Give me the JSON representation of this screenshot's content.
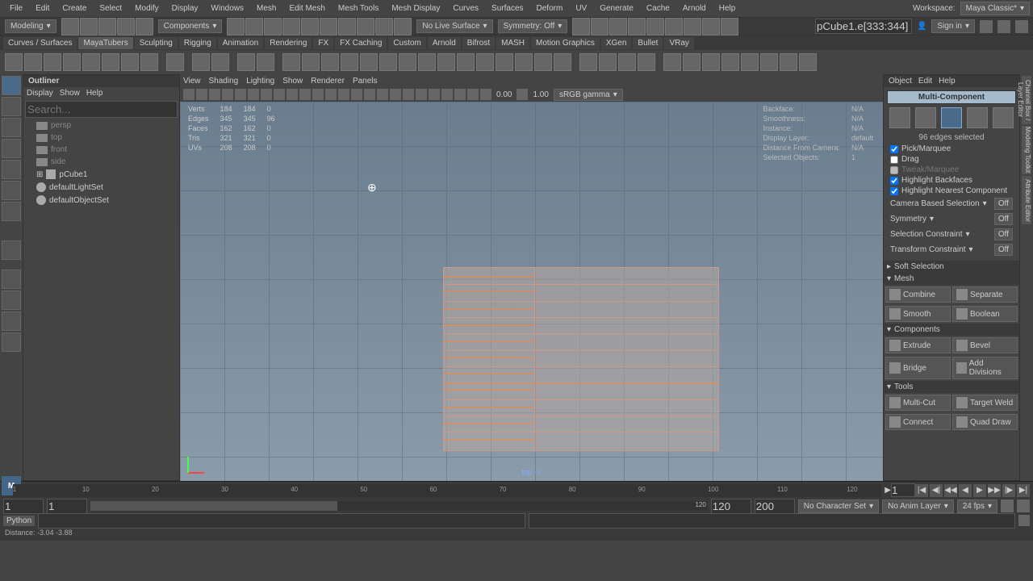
{
  "menubar": [
    "File",
    "Edit",
    "Create",
    "Select",
    "Modify",
    "Display",
    "Windows",
    "Mesh",
    "Edit Mesh",
    "Mesh Tools",
    "Mesh Display",
    "Curves",
    "Surfaces",
    "Deform",
    "UV",
    "Generate",
    "Cache",
    "Arnold",
    "Help"
  ],
  "workspace": {
    "label": "Workspace:",
    "value": "Maya Classic*"
  },
  "status": {
    "menuset": "Modeling",
    "componentmode": "Components",
    "symmetry": "Symmetry: Off",
    "livesurf": "No Live Surface",
    "signin": "Sign in",
    "selpath": "pCube1.e[333:344]"
  },
  "shelftabs": [
    "Curves / Surfaces",
    "MayaTubers",
    "Sculpting",
    "Rigging",
    "Animation",
    "Rendering",
    "FX",
    "FX Caching",
    "Custom",
    "Arnold",
    "Bifrost",
    "MASH",
    "Motion Graphics",
    "XGen",
    "Bullet",
    "VRay"
  ],
  "shelftabs_active": 1,
  "outliner": {
    "title": "Outliner",
    "menus": [
      "Display",
      "Show",
      "Help"
    ],
    "search_ph": "Search...",
    "items": [
      {
        "name": "persp",
        "type": "cam",
        "dim": true
      },
      {
        "name": "top",
        "type": "cam",
        "dim": true
      },
      {
        "name": "front",
        "type": "cam",
        "dim": true
      },
      {
        "name": "side",
        "type": "cam",
        "dim": true
      },
      {
        "name": "pCube1",
        "type": "cube",
        "dim": false
      },
      {
        "name": "defaultLightSet",
        "type": "set",
        "dim": false
      },
      {
        "name": "defaultObjectSet",
        "type": "set",
        "dim": false
      }
    ]
  },
  "viewport": {
    "menus": [
      "View",
      "Shading",
      "Lighting",
      "Show",
      "Renderer",
      "Panels"
    ],
    "time0": "0.00",
    "time1": "1.00",
    "colorspace": "sRGB gamma",
    "stats": {
      "rows": [
        "Verts",
        "Edges",
        "Faces",
        "Tris",
        "UVs"
      ],
      "col1": [
        "184",
        "345",
        "162",
        "321",
        "208"
      ],
      "col2": [
        "184",
        "345",
        "162",
        "321",
        "208"
      ],
      "col3": [
        "0",
        "96",
        "0",
        "0",
        "0"
      ]
    },
    "hud": {
      "rows": [
        "Backface:",
        "Smoothness:",
        "Instance:",
        "Display Layer:",
        "Distance From Camera:",
        "Selected Objects:"
      ],
      "vals": [
        "N/A",
        "N/A",
        "N/A",
        "default",
        "N/A",
        "1"
      ]
    },
    "viewname": "top  -Y"
  },
  "attributes": {
    "menus": [
      "Object",
      "Edit",
      "Help"
    ],
    "multi": "Multi-Component",
    "selinfo": "96 edges selected",
    "checks": [
      "Pick/Marquee",
      "Drag",
      "Tweak/Marquee",
      "Highlight Backfaces",
      "Highlight Nearest Component"
    ],
    "checksOn": [
      true,
      false,
      false,
      true,
      true
    ],
    "rows": [
      {
        "label": "Camera Based Selection",
        "val": "Off"
      },
      {
        "label": "Symmetry",
        "val": "Off"
      },
      {
        "label": "Selection Constraint",
        "val": "Off"
      },
      {
        "label": "Transform Constraint",
        "val": "Off"
      }
    ],
    "groups": [
      {
        "title": "Soft Selection",
        "collapsed": true
      },
      {
        "title": "Mesh",
        "buttons": [
          [
            "Combine",
            "Separate"
          ],
          [
            "Smooth",
            "Boolean"
          ]
        ]
      },
      {
        "title": "Components",
        "buttons": [
          [
            "Extrude",
            "Bevel"
          ],
          [
            "Bridge",
            "Add Divisions"
          ]
        ]
      },
      {
        "title": "Tools",
        "buttons": [
          [
            "Multi-Cut",
            "Target Weld"
          ],
          [
            "Connect",
            "Quad Draw"
          ]
        ]
      }
    ]
  },
  "rightbar": [
    "Channel Box / Layer Editor",
    "Modeling Toolkit",
    "Attribute Editor"
  ],
  "timeline": {
    "ticks": [
      "1",
      "10",
      "20",
      "30",
      "40",
      "50",
      "60",
      "70",
      "80",
      "90",
      "100",
      "110",
      "120"
    ]
  },
  "range": {
    "f0": "1",
    "f1": "1",
    "f2": "120",
    "f3": "120",
    "f4": "200",
    "charset": "No Character Set",
    "animlayer": "No Anim Layer",
    "fps": "24 fps"
  },
  "cmd": {
    "lang": "Python"
  },
  "help": "Distance:   -3.04     -3.88"
}
